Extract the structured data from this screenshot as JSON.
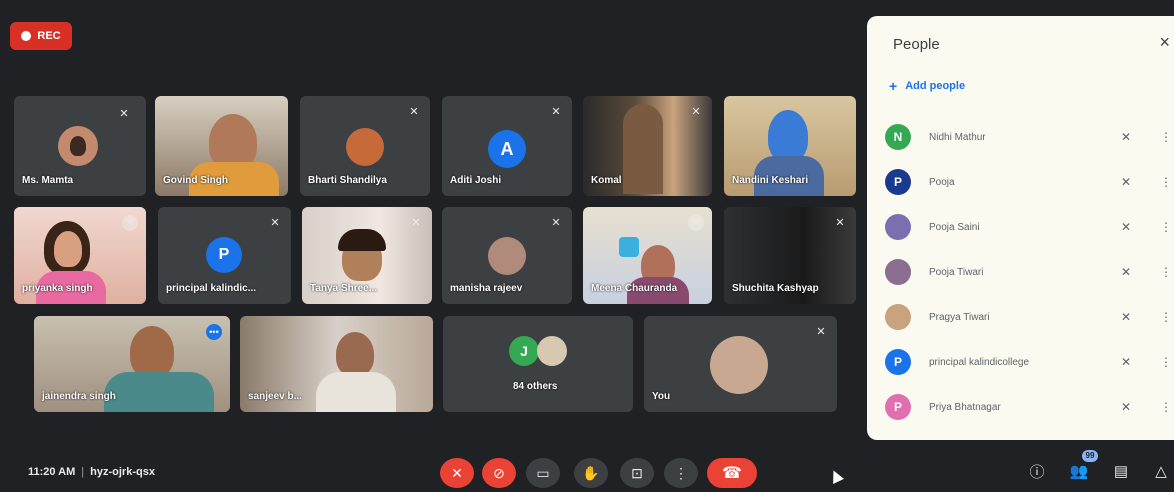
{
  "recording": {
    "label": "REC"
  },
  "tiles": [
    {
      "name": "Ms. Mamta"
    },
    {
      "name": "Govind Singh"
    },
    {
      "name": "Bharti Shandilya"
    },
    {
      "name": "Aditi Joshi",
      "initial": "A"
    },
    {
      "name": "Komal"
    },
    {
      "name": "Nandini Keshari"
    },
    {
      "name": "priyanka singh"
    },
    {
      "name": "principal kalindic...",
      "initial": "P"
    },
    {
      "name": "Tanya Shree..."
    },
    {
      "name": "manisha rajeev"
    },
    {
      "name": "Meena Chauranda"
    },
    {
      "name": "Shuchita Kashyap"
    },
    {
      "name": "jainendra singh"
    },
    {
      "name": "sanjeev b..."
    },
    {
      "name": "84 others",
      "initial": "J"
    },
    {
      "name": "You"
    }
  ],
  "people_panel": {
    "title": "People",
    "close_icon": "×",
    "add_people_label": "Add people",
    "participants": [
      {
        "name": "Nidhi Mathur",
        "initial": "N",
        "color": "#34a853"
      },
      {
        "name": "Pooja",
        "initial": "P",
        "color": "#1a3a8f"
      },
      {
        "name": "Pooja Saini",
        "initial": "",
        "color": "#7b6fb0"
      },
      {
        "name": "Pooja Tiwari",
        "initial": "",
        "color": "#8a6d8f"
      },
      {
        "name": "Pragya Tiwari",
        "initial": "",
        "color": "#c9a27e"
      },
      {
        "name": "principal kalindicollege",
        "initial": "P",
        "color": "#1a73e8"
      },
      {
        "name": "Priya Bhatnagar",
        "initial": "P",
        "color": "#e06fb1"
      }
    ]
  },
  "bottom_bar": {
    "time": "11:20 AM",
    "meeting_code": "hyz-ojrk-qsx",
    "people_count": "99"
  },
  "colors": {
    "accent": "#8ab4f8",
    "danger": "#ea4335",
    "tile_bg": "#3c4043",
    "background": "#1f2124"
  }
}
